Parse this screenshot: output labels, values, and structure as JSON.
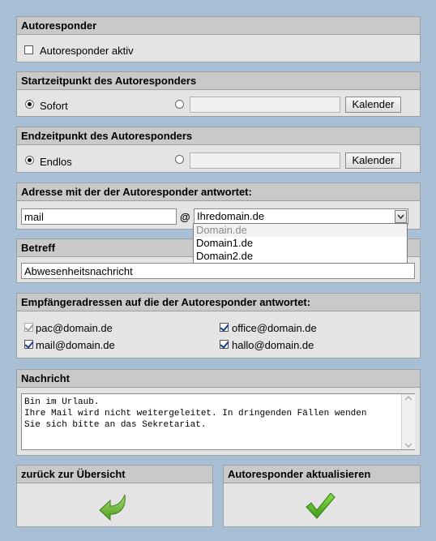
{
  "autoresponder": {
    "title": "Autoresponder",
    "active_label": "Autoresponder aktiv",
    "active_checked": false
  },
  "start": {
    "title": "Startzeitpunkt des Autoresponders",
    "option_now_label": "Sofort",
    "date_value": "",
    "calendar_button": "Kalender"
  },
  "end": {
    "title": "Endzeitpunkt des Autoresponders",
    "option_endless_label": "Endlos",
    "date_value": "",
    "calendar_button": "Kalender"
  },
  "address": {
    "title": "Adresse mit der der Autoresponder antwortet:",
    "local_part": "mail",
    "at_sign": "@",
    "selected_domain": "Ihredomain.de",
    "dropdown_options": [
      "Domain.de",
      "Domain1.de",
      "Domain2.de"
    ]
  },
  "subject": {
    "title": "Betreff",
    "value": "Abwesenheitsnachricht"
  },
  "recipients": {
    "title": "Empfängeradressen auf die der Autoresponder antwortet:",
    "items": [
      {
        "address": "pac@domain.de",
        "checked": true,
        "disabled": true
      },
      {
        "address": "office@domain.de",
        "checked": true,
        "disabled": false
      },
      {
        "address": "mail@domain.de",
        "checked": true,
        "disabled": false
      },
      {
        "address": "hallo@domain.de",
        "checked": true,
        "disabled": false
      }
    ]
  },
  "message": {
    "title": "Nachricht",
    "value": "Bin im Urlaub.\nIhre Mail wird nicht weitergeleitet. In dringenden Fällen wenden\nSie sich bitte an das Sekretariat."
  },
  "actions": {
    "back_title": "zurück zur Übersicht",
    "update_title": "Autoresponder aktualisieren"
  },
  "colors": {
    "background": "#a9bfd6",
    "panel": "#e4e4e4",
    "panel_header": "#c9c9c9",
    "back_arrow": "#6fb33a",
    "checkmark": "#4caf22"
  }
}
